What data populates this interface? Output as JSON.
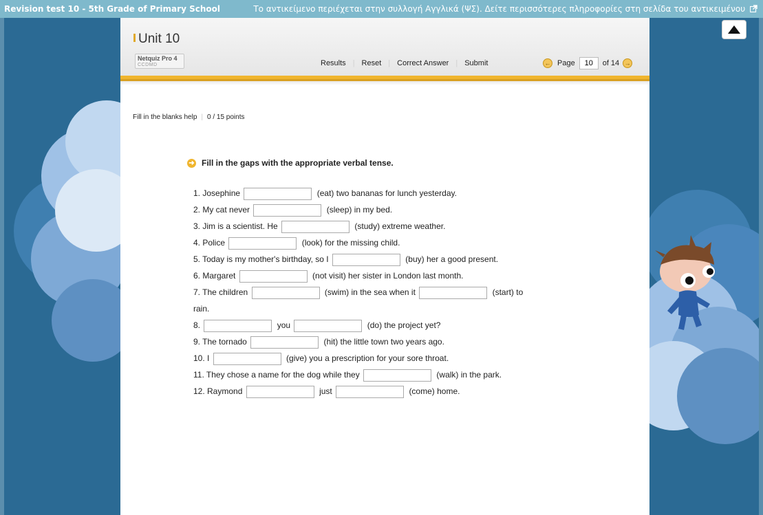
{
  "topbar": {
    "title": "Revision test 10 - 5th Grade of Primary School",
    "info": "Το αντικείμενο περιέχεται στην συλλογή Αγγλικά (ΨΣ). Δείτε περισσότερες πληροφορίες στη σελίδα του αντικειμένου"
  },
  "header": {
    "unit_title": "Unit 10",
    "logo_title": "Netquiz Pro 4",
    "logo_sub": "CCDMD"
  },
  "nav": {
    "results": "Results",
    "reset": "Reset",
    "correct_answer": "Correct Answer",
    "submit": "Submit"
  },
  "pager": {
    "page_label": "Page",
    "current_page": "10",
    "of_label": "of 14"
  },
  "help": {
    "label": "Fill in the blanks help",
    "points": "0 / 15 points"
  },
  "instruction": "Fill in the gaps with the appropriate verbal tense.",
  "questions": [
    {
      "p1": "1. Josephine",
      "p2": "(eat) two bananas for lunch yesterday."
    },
    {
      "p1": "2. My cat never",
      "p2": "(sleep) in my bed."
    },
    {
      "p1": "3. Jim is a scientist. He",
      "p2": "(study) extreme weather."
    },
    {
      "p1": "4. Police",
      "p2": "(look) for the missing child."
    },
    {
      "p1": "5. Today is my mother's birthday, so I",
      "p2": "(buy) her a good present."
    },
    {
      "p1": "6. Margaret",
      "p2": "(not visit) her sister in London last month."
    },
    {
      "p1": "7. The children",
      "p2": "(swim) in the sea when it",
      "p3": "(start) to",
      "p4": "rain."
    },
    {
      "p1": "8.",
      "p2": "you",
      "p3": "(do) the project yet?"
    },
    {
      "p1": "9. The tornado",
      "p2": "(hit) the little town two years ago."
    },
    {
      "p1": "10. I",
      "p2": "(give) you a prescription for your sore throat."
    },
    {
      "p1": "11. They chose a name for the dog while they",
      "p2": "(walk) in the park."
    },
    {
      "p1": "12. Raymond",
      "p2": "just",
      "p3": "(come) home."
    }
  ]
}
